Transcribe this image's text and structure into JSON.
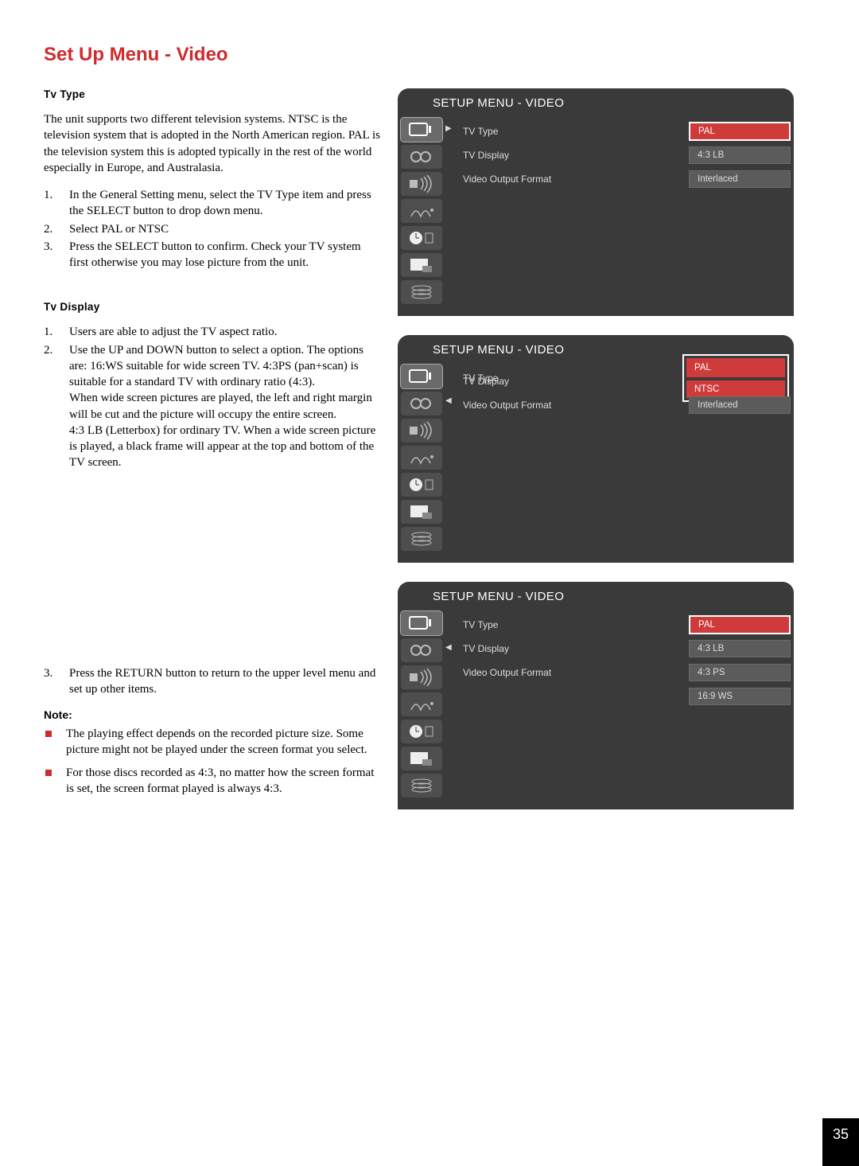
{
  "page": {
    "title": "Set Up Menu - Video",
    "number": "35"
  },
  "tvtype": {
    "heading": "Tv Type",
    "intro": "The unit supports two different television systems. NTSC is the television system that is adopted in the North American region. PAL is the television system this is adopted typically in the rest of the world especially in Europe, and Australasia.",
    "steps": [
      "In the General Setting menu, select the TV Type item and press the SELECT button to drop down menu.",
      "Select PAL or NTSC",
      "Press the SELECT button to confirm. Check your TV system first otherwise you may lose picture from the unit."
    ]
  },
  "tvdisplay": {
    "heading": "Tv Display",
    "steps12": [
      "Users are able to adjust the TV aspect ratio.",
      "Use the UP and DOWN button to select a option. The options are: 16:WS suitable for wide screen TV. 4:3PS (pan+scan) is suitable for a standard TV with ordinary ratio (4:3)."
    ],
    "step2_cont1": "When wide screen pictures are played, the left and right margin will be cut and the picture will occupy the entire screen.",
    "step2_cont2": "4:3 LB (Letterbox) for ordinary TV. When a wide screen picture is played, a black frame will appear at the top and bottom of the TV screen.",
    "step3": "Press the RETURN button to return to the upper level menu and set up other items.",
    "note_head": "Note:",
    "notes": [
      "The playing effect depends on the recorded picture size. Some picture might not be played under the screen format you select.",
      "For those discs recorded as 4:3, no matter how the screen format is set, the screen format played is always 4:3."
    ]
  },
  "osd": {
    "title": "SETUP MENU - VIDEO",
    "rows": {
      "tvtype": "TV Type",
      "tvdisplay": "TV Display",
      "vof": "Video Output Format"
    },
    "vals": {
      "pal": "PAL",
      "ntsc": "NTSC",
      "lb": "4:3 LB",
      "ps": "4:3 PS",
      "ws": "16:9 WS",
      "inter": "Interlaced"
    }
  }
}
